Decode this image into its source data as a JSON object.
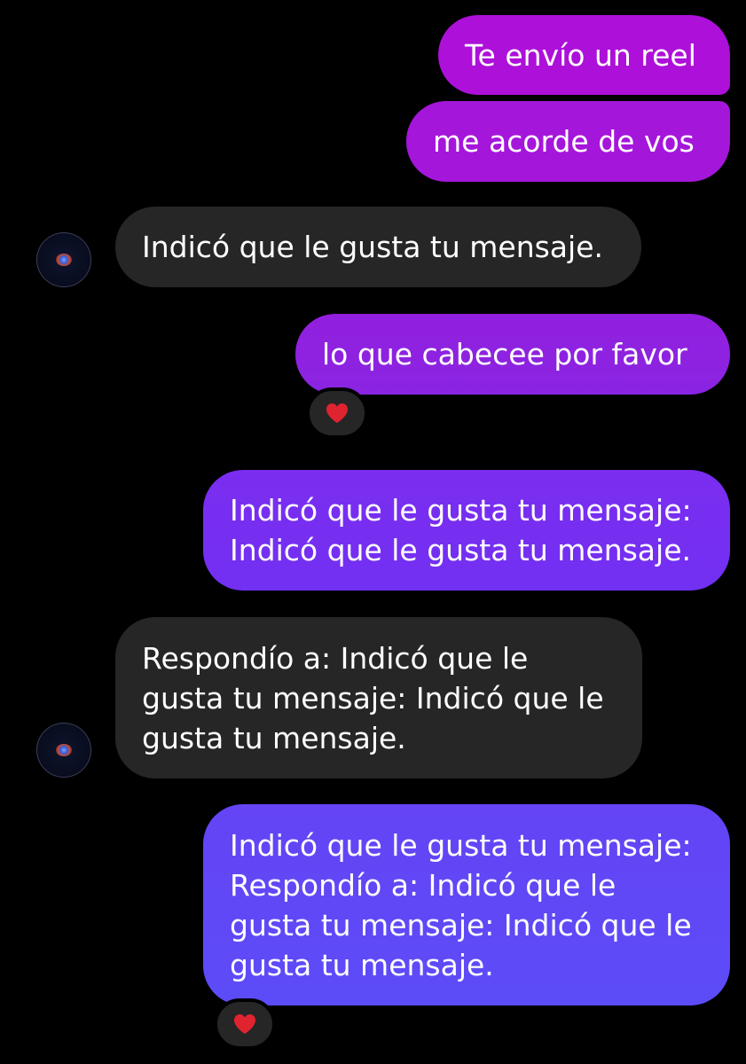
{
  "theme": {
    "background": "#000000",
    "received_bubble": "#262626",
    "sent_gradient_top": "#b00fd8",
    "sent_gradient_bottom": "#5a4cf7",
    "reaction_heart": "#e0242f"
  },
  "messages": [
    {
      "direction": "sent",
      "text": "Te envío un reel"
    },
    {
      "direction": "sent",
      "text": "me acorde de vos"
    },
    {
      "direction": "received",
      "text": "Indicó que le gusta tu mensaje.",
      "avatar_icon": "nebula-avatar-icon"
    },
    {
      "direction": "sent",
      "text": "lo que cabecee por favor",
      "reaction": "heart-icon"
    },
    {
      "direction": "sent",
      "lines": [
        "Indicó que le gusta tu mensaje:",
        "Indicó que le gusta tu mensaje."
      ]
    },
    {
      "direction": "received",
      "lines": [
        "Respondío a: Indicó que le",
        "gusta tu mensaje: Indicó que le",
        "gusta tu mensaje."
      ],
      "avatar_icon": "nebula-avatar-icon"
    },
    {
      "direction": "sent",
      "lines": [
        "Indicó que le gusta tu mensaje:",
        "Respondío a: Indicó que le",
        "gusta tu mensaje: Indicó que le",
        "gusta tu mensaje."
      ],
      "reaction": "heart-icon"
    }
  ]
}
